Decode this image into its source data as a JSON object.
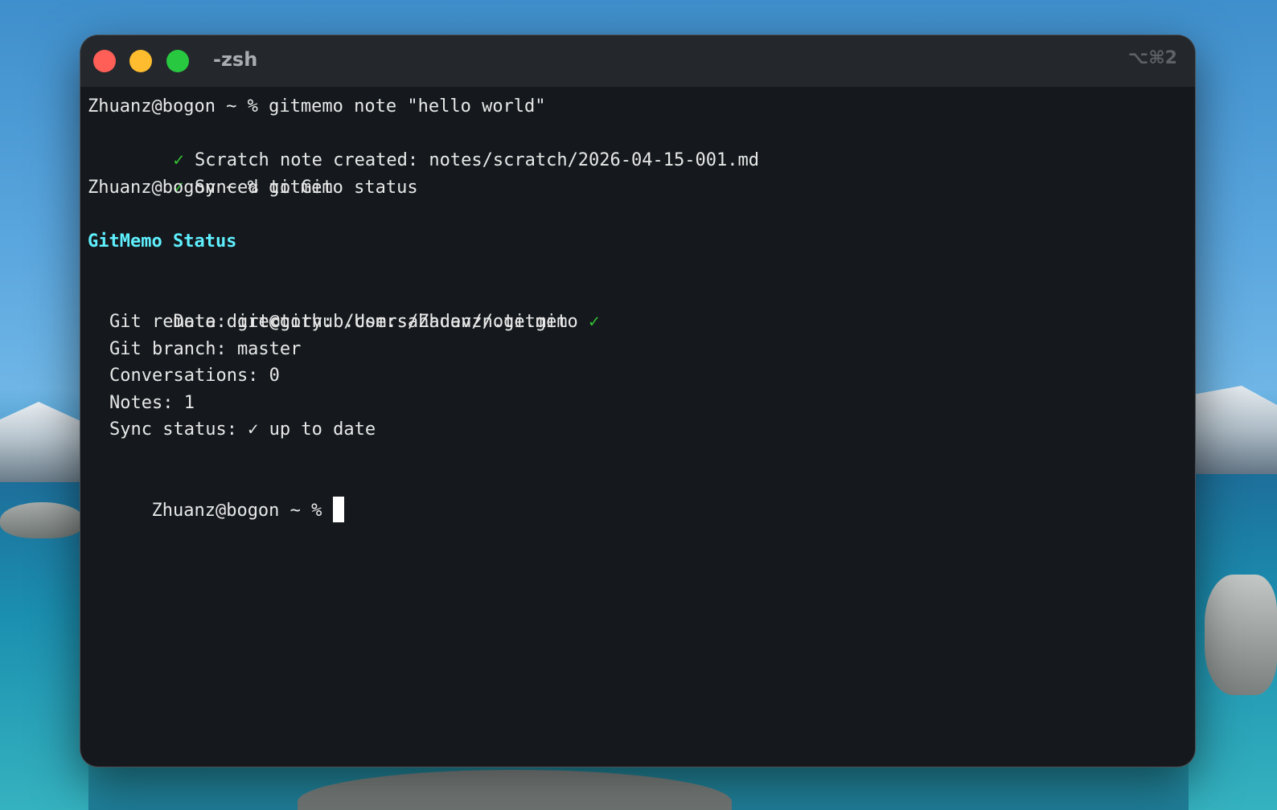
{
  "window": {
    "title": "-zsh",
    "shortcut": "⌥⌘2"
  },
  "terminal": {
    "prompt": "Zhuanz@bogon ~ %",
    "lines": [
      {
        "text": "Zhuanz@bogon ~ % gitmemo note \"hello world\""
      },
      {
        "check": "✓",
        "text": "Scratch note created: notes/scratch/2026-04-15-001.md"
      },
      {
        "check": "✓",
        "text": "Synced to Git"
      },
      {
        "text": "Zhuanz@bogon ~ % gitmemo status"
      },
      {
        "text": ""
      },
      {
        "heading": "GitMemo Status"
      },
      {
        "text": ""
      },
      {
        "text": "Data directory: /Users/Zhuanz/.gitmemo",
        "check": "✓"
      },
      {
        "text": "Git remote: git@github.com:sahadev/note.git"
      },
      {
        "text": "Git branch: master"
      },
      {
        "text": "Conversations: 0"
      },
      {
        "text": "Notes: 1"
      },
      {
        "text": "Sync status: ✓ up to date"
      },
      {
        "text": ""
      },
      {
        "text": "Zhuanz@bogon ~ %"
      }
    ]
  },
  "colors": {
    "terminal_bg": "#15191d",
    "titlebar_bg": "#24272b",
    "text": "#e8e8e8",
    "check_green": "#36c536",
    "heading_cyan": "#5ff0ff",
    "close": "#ff5f57",
    "minimize": "#febc2e",
    "zoom": "#28c840"
  }
}
